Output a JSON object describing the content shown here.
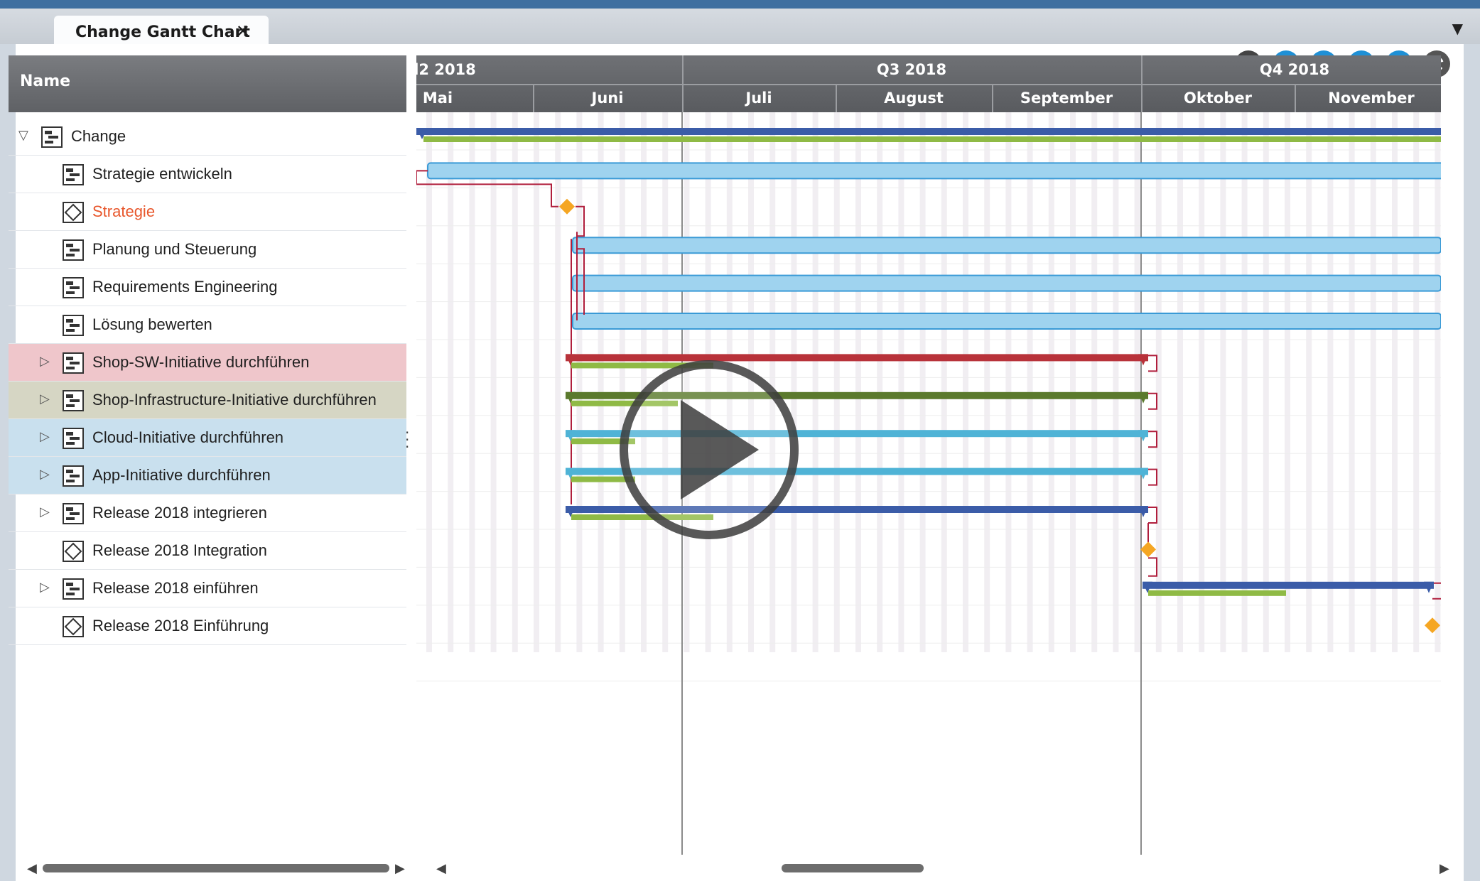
{
  "tab": {
    "title": "Change Gantt Chart",
    "close_glyph": "✕",
    "menu_glyph": "▼"
  },
  "toolbar": {
    "buttons": [
      {
        "name": "fit-all-icon",
        "color": "#444444"
      },
      {
        "name": "go-to-start-icon",
        "color": "#1e90d6"
      },
      {
        "name": "filter-icon",
        "color": "#1e90d6"
      },
      {
        "name": "go-to-end-icon",
        "color": "#1e90d6"
      },
      {
        "name": "calendar-icon",
        "color": "#1e90d6"
      },
      {
        "name": "refresh-icon",
        "color": "#444444"
      }
    ]
  },
  "tree": {
    "header": "Name",
    "rows": [
      {
        "label": "Change",
        "icon": "project-icon",
        "toggle": "▽",
        "level": 0,
        "highlight": ""
      },
      {
        "label": "Strategie entwickeln",
        "icon": "task-icon",
        "toggle": "",
        "level": 1,
        "highlight": ""
      },
      {
        "label": "Strategie",
        "icon": "milestone-icon",
        "toggle": "",
        "level": 1,
        "highlight": "",
        "label_color": "#e8572c"
      },
      {
        "label": "Planung und Steuerung",
        "icon": "task-icon",
        "toggle": "",
        "level": 1,
        "highlight": ""
      },
      {
        "label": "Requirements Engineering",
        "icon": "task-icon",
        "toggle": "",
        "level": 1,
        "highlight": ""
      },
      {
        "label": "Lösung bewerten",
        "icon": "task-icon",
        "toggle": "",
        "level": 1,
        "highlight": ""
      },
      {
        "label": "Shop-SW-Initiative durchführen",
        "icon": "task-icon",
        "toggle": "▷",
        "level": 1,
        "highlight": "red"
      },
      {
        "label": "Shop-Infrastructure-Initiative durchführen",
        "icon": "task-icon",
        "toggle": "▷",
        "level": 1,
        "highlight": "green"
      },
      {
        "label": "Cloud-Initiative durchführen",
        "icon": "task-icon",
        "toggle": "▷",
        "level": 1,
        "highlight": "blue"
      },
      {
        "label": "App-Initiative durchführen",
        "icon": "task-icon",
        "toggle": "▷",
        "level": 1,
        "highlight": "blue"
      },
      {
        "label": "Release 2018 integrieren",
        "icon": "task-icon",
        "toggle": "▷",
        "level": 1,
        "highlight": ""
      },
      {
        "label": "Release 2018 Integration",
        "icon": "milestone-icon",
        "toggle": "",
        "level": 1,
        "highlight": ""
      },
      {
        "label": "Release 2018 einführen",
        "icon": "task-icon",
        "toggle": "▷",
        "level": 1,
        "highlight": ""
      },
      {
        "label": "Release 2018 Einführung",
        "icon": "milestone-icon",
        "toggle": "",
        "level": 1,
        "highlight": ""
      }
    ]
  },
  "timeline": {
    "quarters": [
      {
        "label": "l2 2018"
      },
      {
        "label": "Q3 2018"
      },
      {
        "label": "Q4 2018"
      }
    ],
    "months": [
      "Mai",
      "Juni",
      "Juli",
      "August",
      "September",
      "Oktober",
      "November"
    ]
  },
  "gantt_colors": {
    "summary": "#3b5ca8",
    "progress": "#8fba45",
    "task": "#9fd3ef",
    "task_border": "#3a9ad6",
    "red": "#b8323a",
    "olive": "#5b7a2d",
    "cyan": "#4fb3d6",
    "milestone": "#f5a623",
    "link": "#b01e3c"
  },
  "scroll": {
    "left_arrow": "◀",
    "right_arrow": "▶"
  }
}
